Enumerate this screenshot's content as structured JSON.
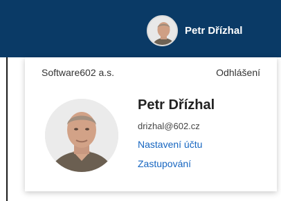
{
  "header": {
    "user_name": "Petr Dřízhal"
  },
  "account_panel": {
    "company": "Software602 a.s.",
    "logout_label": "Odhlášení",
    "full_name": "Petr Dřízhal",
    "email": "drizhal@602.cz",
    "links": {
      "account_settings": "Nastavení účtu",
      "delegation": "Zastupování"
    }
  },
  "colors": {
    "header_bg": "#0a3a66",
    "link": "#1565c0"
  }
}
